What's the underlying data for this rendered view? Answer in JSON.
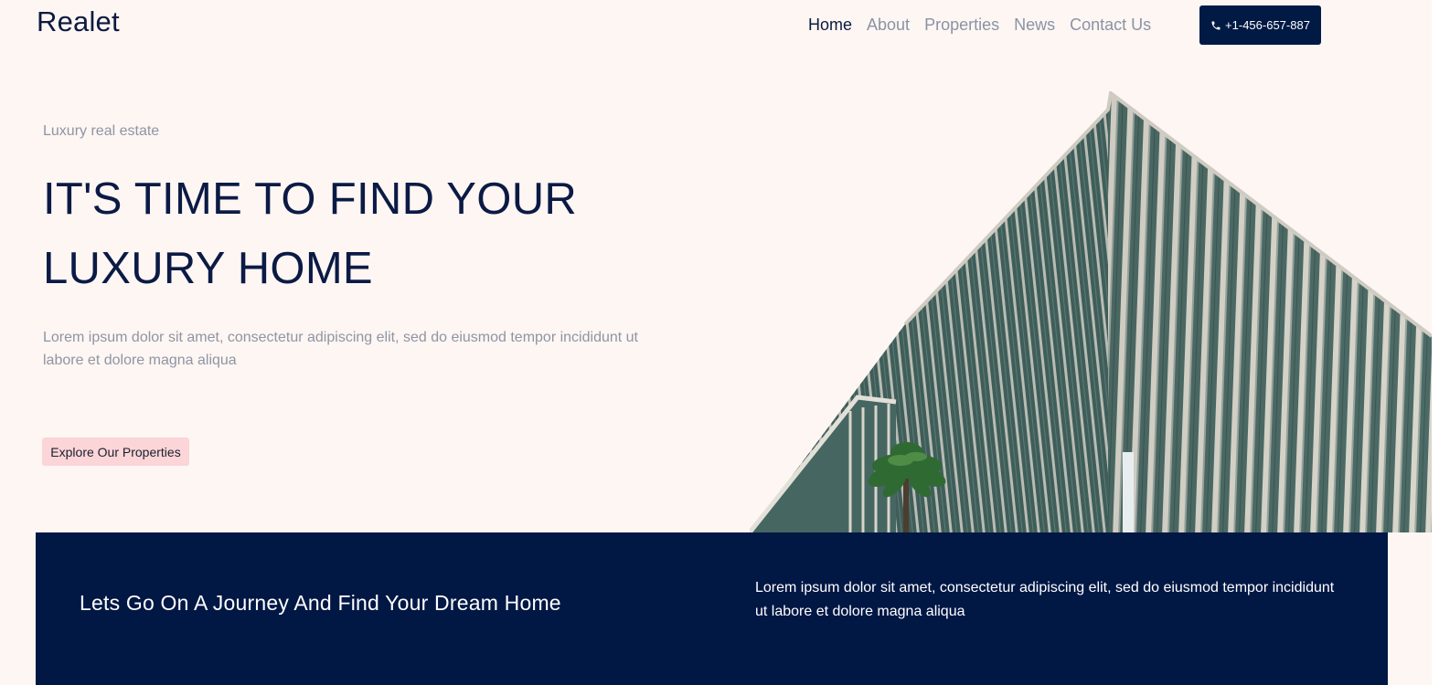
{
  "brand": {
    "logo": "Realet"
  },
  "nav": {
    "items": [
      {
        "label": "Home",
        "active": true
      },
      {
        "label": "About",
        "active": false
      },
      {
        "label": "Properties",
        "active": false
      },
      {
        "label": "News",
        "active": false
      },
      {
        "label": "Contact Us",
        "active": false
      }
    ],
    "phone": {
      "icon": "phone-icon",
      "label": "+1-456-657-887"
    }
  },
  "hero": {
    "kicker": "Luxury real estate",
    "title": "IT'S TIME TO FIND YOUR LUXURY HOME",
    "text": "Lorem ipsum dolor sit amet, consectetur adipiscing elit, sed do eiusmod tempor incididunt ut labore et dolore magna aliqua",
    "cta": "Explore Our Properties",
    "image": "building-photo"
  },
  "band": {
    "title": "Lets Go On A Journey And Find Your Dream Home",
    "text": "Lorem ipsum dolor sit amet, consectetur adipiscing elit, sed do eiusmod tempor incididunt ut labore et dolore magna aliqua"
  },
  "colors": {
    "background": "#fdf6f3",
    "navy": "#011744",
    "heading": "#0b1a45",
    "muted": "#8f95a3",
    "cta_bg": "#fbd5d8",
    "building_glass": "#4d6b66"
  }
}
